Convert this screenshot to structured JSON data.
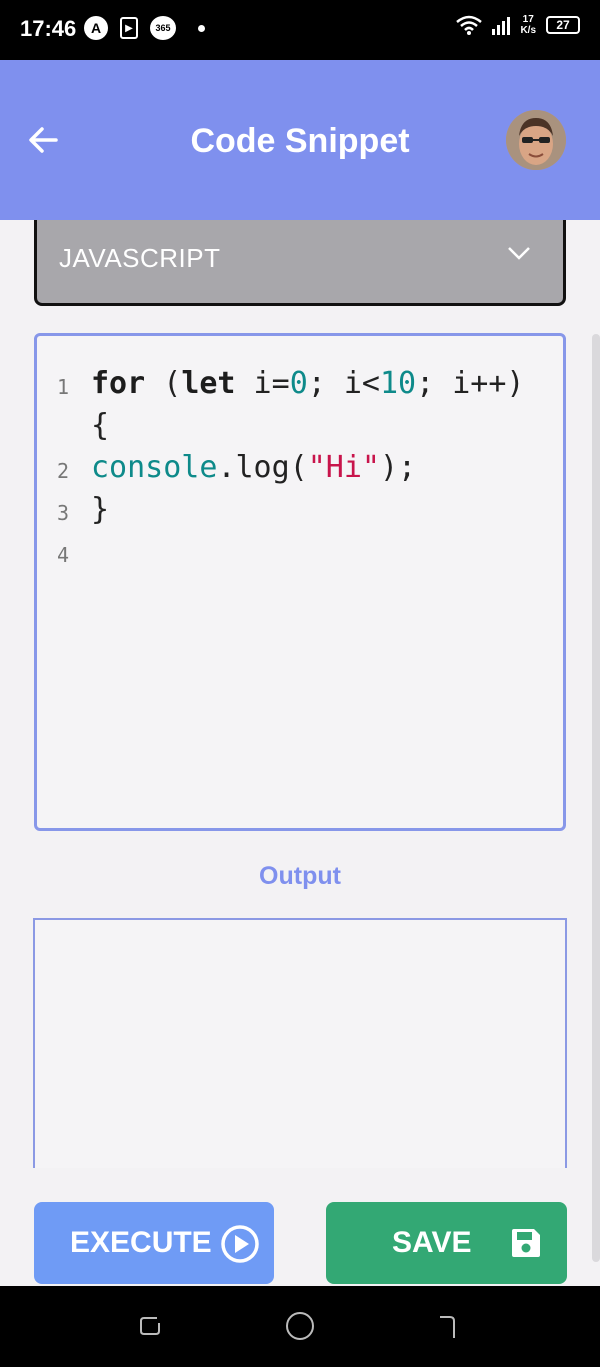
{
  "status_bar": {
    "time": "17:46",
    "notif_app_icon": "A",
    "notif_play_icon": "▶",
    "notif_365_icon": "365",
    "net_speed_value": "17",
    "net_speed_unit": "K/s",
    "battery": "27"
  },
  "app_bar": {
    "title": "Code Snippet"
  },
  "language": {
    "selected": "JAVASCRIPT"
  },
  "editor": {
    "lines": [
      {
        "no": "1",
        "parts": [
          [
            "kw",
            "for"
          ],
          [
            "pl",
            " ("
          ],
          [
            "kw",
            "let"
          ],
          [
            "pl",
            " i="
          ],
          [
            "num",
            "0"
          ],
          [
            "pl",
            "; i<"
          ],
          [
            "num",
            "10"
          ],
          [
            "pl",
            "; i++)"
          ]
        ]
      },
      {
        "no": "",
        "parts": [
          [
            "pl",
            "{"
          ]
        ]
      },
      {
        "no": "2",
        "parts": [
          [
            "fn",
            "console"
          ],
          [
            "pl",
            ".log("
          ],
          [
            "str",
            "\"Hi\""
          ],
          [
            "pl",
            ");"
          ]
        ]
      },
      {
        "no": "3",
        "parts": [
          [
            "pl",
            "}"
          ]
        ]
      },
      {
        "no": "4",
        "parts": []
      }
    ]
  },
  "output": {
    "label": "Output",
    "content": ""
  },
  "buttons": {
    "execute_label": "EXECUTE",
    "save_label": "SAVE"
  },
  "colors": {
    "app_bar": "#7f90ee",
    "execute": "#6f9bf5",
    "save": "#33a874",
    "string": "#c8144b",
    "number": "#0e8a8a"
  }
}
